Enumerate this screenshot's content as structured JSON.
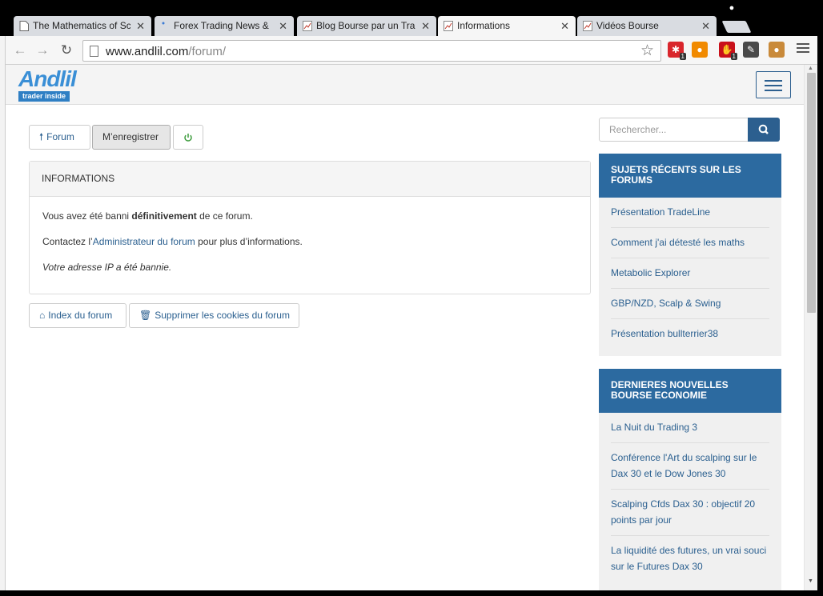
{
  "browser": {
    "tabs": [
      {
        "label": "The Mathematics of Sc",
        "favicon": "page-icon",
        "active": false
      },
      {
        "label": "Forex Trading News &",
        "favicon": "dot-icon",
        "active": false
      },
      {
        "label": "Blog Bourse par un Tra",
        "favicon": "chart-icon",
        "active": false
      },
      {
        "label": "Informations",
        "favicon": "chart-icon",
        "active": true
      },
      {
        "label": "Vidéos Bourse",
        "favicon": "chart-icon",
        "active": false
      }
    ],
    "close_glyph": "✕",
    "url_host": "www.andlil.com",
    "url_path": "/forum/",
    "extensions": [
      {
        "name": "extension-red-star-icon",
        "glyph": "✱",
        "color": "#d9262c",
        "badge": "1"
      },
      {
        "name": "extension-orange-swirl-icon",
        "glyph": "●",
        "color": "#f18a00",
        "badge": ""
      },
      {
        "name": "extension-adblock-icon",
        "glyph": "✋",
        "color": "#c9111b",
        "badge": "1"
      },
      {
        "name": "extension-evernote-icon",
        "glyph": "✎",
        "color": "#4a4a4a",
        "badge": ""
      },
      {
        "name": "extension-cookie-icon",
        "glyph": "●",
        "color": "#c98a3a",
        "badge": ""
      }
    ]
  },
  "site": {
    "logo_main": "Andlil",
    "logo_sub": "trader inside"
  },
  "buttons": {
    "forum": "Forum",
    "register": "M’enregistrer",
    "index": "Index du forum",
    "delete_cookies": "Supprimer les cookies du forum"
  },
  "panel": {
    "title": "INFORMATIONS",
    "line1_pre": "Vous avez été banni ",
    "line1_bold": "définitivement",
    "line1_post": " de ce forum.",
    "line2_pre": "Contactez l’",
    "line2_link": "Administrateur du forum",
    "line2_post": " pour plus d’informations.",
    "line3": "Votre adresse IP a été bannie."
  },
  "search": {
    "placeholder": "Rechercher..."
  },
  "recent_topics": {
    "title": "SUJETS RÉCENTS SUR LES FORUMS",
    "items": [
      "Présentation TradeLine",
      "Comment j'ai détesté les maths",
      "Metabolic Explorer",
      "GBP/NZD, Scalp & Swing",
      "Présentation bullterrier38"
    ]
  },
  "news": {
    "title": "DERNIERES NOUVELLES BOURSE ECONOMIE",
    "items": [
      "La Nuit du Trading 3",
      "Conférence l'Art du scalping sur le Dax 30 et le Dow Jones 30",
      "Scalping Cfds Dax 30 : objectif 20 points par jour",
      "La liquidité des futures, un vrai souci sur le Futures Dax 30"
    ]
  },
  "colors": {
    "brand_blue": "#2c6aa0",
    "link_blue": "#2a5f8f",
    "logout_green": "#3a9a3a"
  }
}
